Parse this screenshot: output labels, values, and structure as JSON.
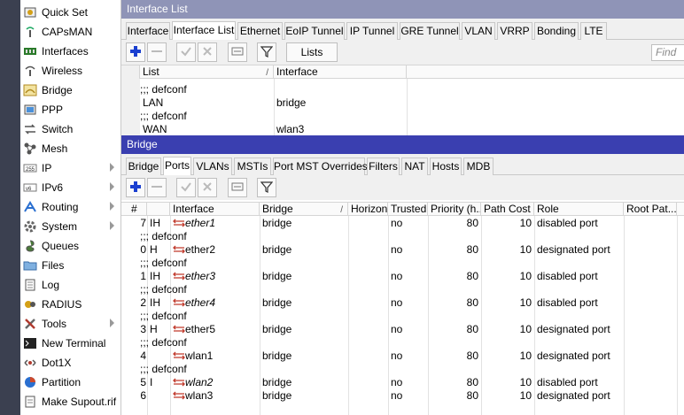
{
  "sidebar": {
    "items": [
      {
        "label": "Quick Set",
        "icon": "quick-set-icon"
      },
      {
        "label": "CAPsMAN",
        "icon": "capsman-icon"
      },
      {
        "label": "Interfaces",
        "icon": "interfaces-icon"
      },
      {
        "label": "Wireless",
        "icon": "wireless-icon"
      },
      {
        "label": "Bridge",
        "icon": "bridge-icon"
      },
      {
        "label": "PPP",
        "icon": "ppp-icon"
      },
      {
        "label": "Switch",
        "icon": "switch-icon"
      },
      {
        "label": "Mesh",
        "icon": "mesh-icon"
      },
      {
        "label": "IP",
        "icon": "ip-icon",
        "submenu": true
      },
      {
        "label": "IPv6",
        "icon": "ipv6-icon",
        "submenu": true
      },
      {
        "label": "Routing",
        "icon": "routing-icon",
        "submenu": true
      },
      {
        "label": "System",
        "icon": "system-icon",
        "submenu": true
      },
      {
        "label": "Queues",
        "icon": "queues-icon"
      },
      {
        "label": "Files",
        "icon": "files-icon"
      },
      {
        "label": "Log",
        "icon": "log-icon"
      },
      {
        "label": "RADIUS",
        "icon": "radius-icon"
      },
      {
        "label": "Tools",
        "icon": "tools-icon",
        "submenu": true
      },
      {
        "label": "New Terminal",
        "icon": "terminal-icon"
      },
      {
        "label": "Dot1X",
        "icon": "dot1x-icon"
      },
      {
        "label": "Partition",
        "icon": "partition-icon"
      },
      {
        "label": "Make Supout.rif",
        "icon": "supout-icon"
      }
    ]
  },
  "iflist": {
    "title": "Interface List",
    "tabs": [
      "Interface",
      "Interface List",
      "Ethernet",
      "EoIP Tunnel",
      "IP Tunnel",
      "GRE Tunnel",
      "VLAN",
      "VRRP",
      "Bonding",
      "LTE"
    ],
    "active_tab": 1,
    "lists_button": "Lists",
    "find_placeholder": "Find",
    "columns": [
      "List",
      "Interface"
    ],
    "rows": [
      {
        "comment": ";;; defconf"
      },
      {
        "list": "LAN",
        "interface": "bridge"
      },
      {
        "comment": ";;; defconf"
      },
      {
        "list": "WAN",
        "interface": "wlan3"
      }
    ]
  },
  "bridge": {
    "title": "Bridge",
    "tabs": [
      "Bridge",
      "Ports",
      "VLANs",
      "MSTIs",
      "Port MST Overrides",
      "Filters",
      "NAT",
      "Hosts",
      "MDB"
    ],
    "active_tab": 1,
    "columns": [
      "#",
      "",
      "Interface",
      "Bridge",
      "Horizon",
      "Trusted",
      "Priority (h...",
      "Path Cost",
      "Role",
      "Root Pat..."
    ],
    "rows": [
      {
        "num": "7",
        "flags": "IH",
        "iface": "ether1",
        "italic": true,
        "bridge": "bridge",
        "trusted": "no",
        "priority": "80",
        "cost": "10",
        "role": "disabled port"
      },
      {
        "comment": ";;; defconf"
      },
      {
        "num": "0",
        "flags": "H",
        "iface": "ether2",
        "italic": false,
        "bridge": "bridge",
        "trusted": "no",
        "priority": "80",
        "cost": "10",
        "role": "designated port"
      },
      {
        "comment": ";;; defconf"
      },
      {
        "num": "1",
        "flags": "IH",
        "iface": "ether3",
        "italic": true,
        "bridge": "bridge",
        "trusted": "no",
        "priority": "80",
        "cost": "10",
        "role": "disabled port"
      },
      {
        "comment": ";;; defconf"
      },
      {
        "num": "2",
        "flags": "IH",
        "iface": "ether4",
        "italic": true,
        "bridge": "bridge",
        "trusted": "no",
        "priority": "80",
        "cost": "10",
        "role": "disabled port"
      },
      {
        "comment": ";;; defconf"
      },
      {
        "num": "3",
        "flags": "H",
        "iface": "ether5",
        "italic": false,
        "bridge": "bridge",
        "trusted": "no",
        "priority": "80",
        "cost": "10",
        "role": "designated port"
      },
      {
        "comment": ";;; defconf"
      },
      {
        "num": "4",
        "flags": "",
        "iface": "wlan1",
        "italic": false,
        "bridge": "bridge",
        "trusted": "no",
        "priority": "80",
        "cost": "10",
        "role": "designated port"
      },
      {
        "comment": ";;; defconf"
      },
      {
        "num": "5",
        "flags": "I",
        "iface": "wlan2",
        "italic": true,
        "bridge": "bridge",
        "trusted": "no",
        "priority": "80",
        "cost": "10",
        "role": "disabled port"
      },
      {
        "num": "6",
        "flags": "",
        "iface": "wlan3",
        "italic": false,
        "bridge": "bridge",
        "trusted": "no",
        "priority": "80",
        "cost": "10",
        "role": "designated port"
      }
    ]
  },
  "colors": {
    "titlebar_active": "#3a3fb0",
    "titlebar_inactive": "#8f94b7",
    "add_blue": "#1a3fd0",
    "port_icon_red": "#c0392b"
  }
}
